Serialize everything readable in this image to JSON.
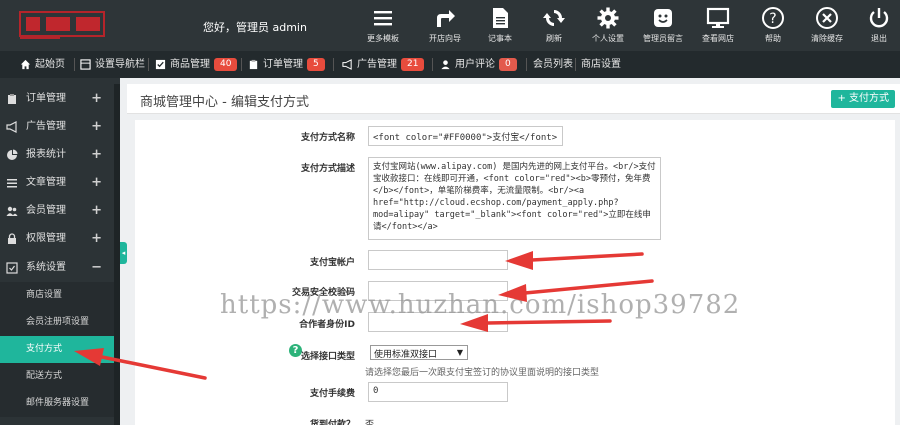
{
  "header": {
    "welcome": "您好，管理员 admin",
    "buttons": [
      {
        "label": "更多模板",
        "icon": "menu-icon"
      },
      {
        "label": "开店向导",
        "icon": "share-arrow-icon"
      },
      {
        "label": "记事本",
        "icon": "notepad-icon"
      },
      {
        "label": "刷新",
        "icon": "refresh-icon"
      },
      {
        "label": "个人设置",
        "icon": "gear-icon"
      },
      {
        "label": "管理员留言",
        "icon": "smile-message-icon"
      },
      {
        "label": "查看网店",
        "icon": "monitor-icon"
      },
      {
        "label": "帮助",
        "icon": "help-icon"
      },
      {
        "label": "清除缓存",
        "icon": "clear-cache-icon"
      },
      {
        "label": "退出",
        "icon": "power-icon"
      }
    ]
  },
  "nav": {
    "home": "起始页",
    "setup_nav": "设置导航栏",
    "goods": "商品管理",
    "goods_count": "40",
    "orders": "订单管理",
    "orders_count": "5",
    "ads": "广告管理",
    "ads_count": "21",
    "comments": "用户评论",
    "comments_count": "0",
    "members": "会员列表",
    "shop_settings": "商店设置"
  },
  "sidebar": {
    "items": [
      {
        "label": "订单管理",
        "toggle": "+"
      },
      {
        "label": "广告管理",
        "toggle": "+"
      },
      {
        "label": "报表统计",
        "toggle": "+"
      },
      {
        "label": "文章管理",
        "toggle": "+"
      },
      {
        "label": "会员管理",
        "toggle": "+"
      },
      {
        "label": "权限管理",
        "toggle": "+"
      },
      {
        "label": "系统设置",
        "toggle": "−"
      }
    ],
    "sub_items": [
      "商店设置",
      "会员注册项设置",
      "支付方式",
      "配送方式",
      "邮件服务器设置"
    ],
    "active_sub": "支付方式"
  },
  "page": {
    "title": "商城管理中心 - 编辑支付方式",
    "add_button": "+ 支付方式"
  },
  "form": {
    "name_label": "支付方式名称",
    "name_value": "<font color=\"#FF0000\">支付宝</font>",
    "desc_label": "支付方式描述",
    "desc_value": "支付宝网站(www.alipay.com) 是国内先进的网上支付平台。<br/>支付宝收款接口：在线即可开通，<font color=\"red\"><b>零预付，免年费</b></font>，单笔阶梯费率，无流量限制。<br/><a href=\"http://cloud.ecshop.com/payment_apply.php?mod=alipay\" target=\"_blank\"><font color=\"red\">立即在线申请</font></a>",
    "account_label": "支付宝帐户",
    "key_label": "交易安全校验码",
    "partner_label": "合作者身份ID",
    "interface_label": "选择接口类型",
    "interface_value": "使用标准双接口",
    "interface_hint": "请选择您最后一次跟支付宝签订的协议里面说明的接口类型",
    "fee_label": "支付手续费",
    "fee_value": "0",
    "cod_label": "货到付款？",
    "cod_value": "否"
  },
  "watermark": "https://www.huzhan.com/ishop39782",
  "colors": {
    "accent": "#1fb69c",
    "header_bg": "#2e3538",
    "badge": "#e84c3d",
    "arrow": "#e53935"
  }
}
